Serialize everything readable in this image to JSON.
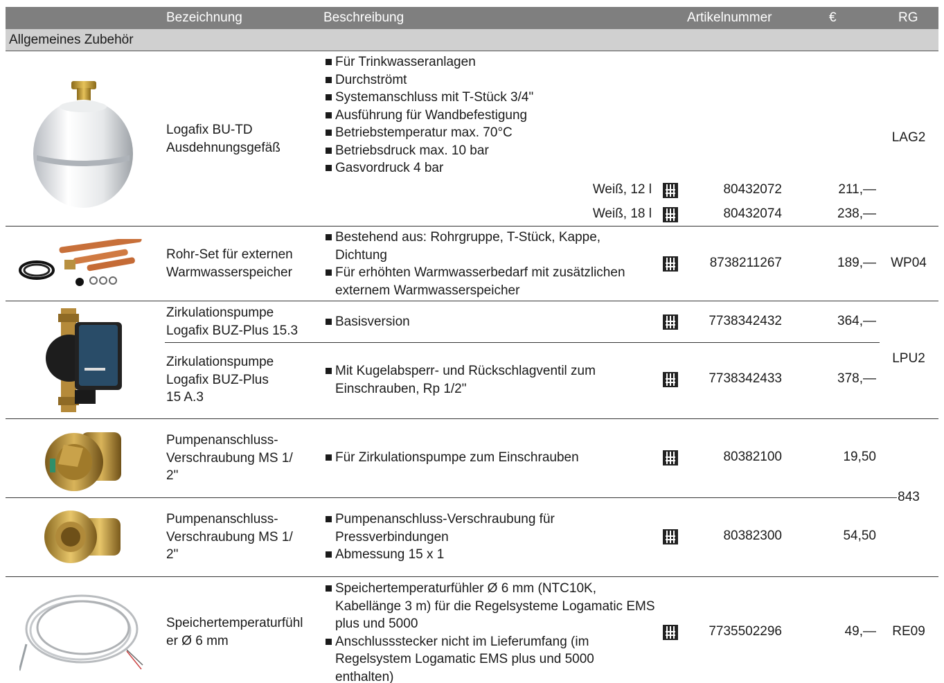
{
  "header": {
    "col_name": "Bezeichnung",
    "col_desc": "Beschreibung",
    "col_art": "Artikelnummer",
    "col_price": "€",
    "col_rg": "RG"
  },
  "section": "Allgemeines Zubehör",
  "products": [
    {
      "name_lines": [
        "Logafix BU-TD",
        "Ausdehnungsgefäß"
      ],
      "desc": [
        "Für Trinkwasseranlagen",
        "Durchströmt",
        "Systemanschluss mit T-Stück 3/4\"",
        "Ausführung für Wandbefestigung",
        "Betriebstemperatur max. 70°C",
        "Betriebsdruck max. 10 bar",
        "Gasvordruck 4 bar"
      ],
      "variants": [
        {
          "label": "Weiß, 12 l",
          "art": "80432072",
          "price": "211,—"
        },
        {
          "label": "Weiß, 18 l",
          "art": "80432074",
          "price": "238,—"
        }
      ],
      "rg": "LAG2"
    },
    {
      "name_lines": [
        "Rohr-Set für externen",
        "Warmwasserspeicher"
      ],
      "desc": [
        "Bestehend aus: Rohrgruppe, T-Stück, Kappe, Dichtung",
        "Für erhöhten Warmwasserbedarf mit zusätzlichen externem Warmwasserspeicher"
      ],
      "art": "8738211267",
      "price": "189,—",
      "rg": "WP04"
    },
    {
      "name_lines": [
        "Zirkulationspumpe",
        "Logafix BUZ-Plus 15.3"
      ],
      "desc": [
        "Basisversion"
      ],
      "art": "7738342432",
      "price": "364,—"
    },
    {
      "name_lines": [
        "Zirkulationspumpe",
        "Logafix BUZ-Plus",
        "15 A.3"
      ],
      "desc": [
        "Mit Kugelabsperr- und Rückschlagventil zum Einschrauben, Rp 1/2\""
      ],
      "art": "7738342433",
      "price": "378,—"
    },
    {
      "name_lines": [
        "Pumpenanschluss-",
        "Verschraubung MS 1/",
        "2\""
      ],
      "desc": [
        "Für Zirkulationspumpe zum Einschrauben"
      ],
      "art": "80382100",
      "price": "19,50"
    },
    {
      "name_lines": [
        "Pumpenanschluss-",
        "Verschraubung MS 1/",
        "2\""
      ],
      "desc": [
        "Pumpenanschluss-Verschraubung für Pressverbindungen",
        "Abmessung 15 x 1"
      ],
      "art": "80382300",
      "price": "54,50"
    },
    {
      "name_lines": [
        "Speichertemperaturfühl",
        "er Ø 6 mm"
      ],
      "desc": [
        "Speichertemperaturfühler Ø 6 mm (NTC10K, Kabellänge 3 m) für die Regelsysteme Logamatic EMS plus und 5000",
        "Anschlussstecker nicht im Lieferumfang (im Regelsystem Logamatic EMS plus und 5000 enthalten)"
      ],
      "art": "7735502296",
      "price": "49,—",
      "rg": "RE09"
    }
  ],
  "rg_shared": {
    "pumps": "LPU2",
    "fittings": "843"
  }
}
